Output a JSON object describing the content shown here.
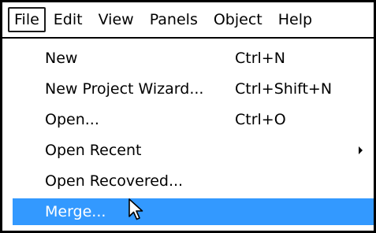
{
  "menubar": {
    "items": [
      {
        "label": "File",
        "active": true
      },
      {
        "label": "Edit"
      },
      {
        "label": "View"
      },
      {
        "label": "Panels"
      },
      {
        "label": "Object"
      },
      {
        "label": "Help"
      }
    ]
  },
  "menu": {
    "items": [
      {
        "label": "New",
        "shortcut": "Ctrl+N"
      },
      {
        "label": "New Project Wizard...",
        "shortcut": "Ctrl+Shift+N"
      },
      {
        "label": "Open...",
        "shortcut": "Ctrl+O"
      },
      {
        "label": "Open Recent",
        "shortcut": "",
        "submenu": true
      },
      {
        "label": "Open Recovered...",
        "shortcut": ""
      },
      {
        "label": "Merge...",
        "shortcut": "",
        "highlighted": true
      }
    ]
  },
  "colors": {
    "highlight": "#3399ff",
    "text": "#000000",
    "highlight_text": "#ffffff"
  },
  "cursor": "arrow-pointer-icon"
}
